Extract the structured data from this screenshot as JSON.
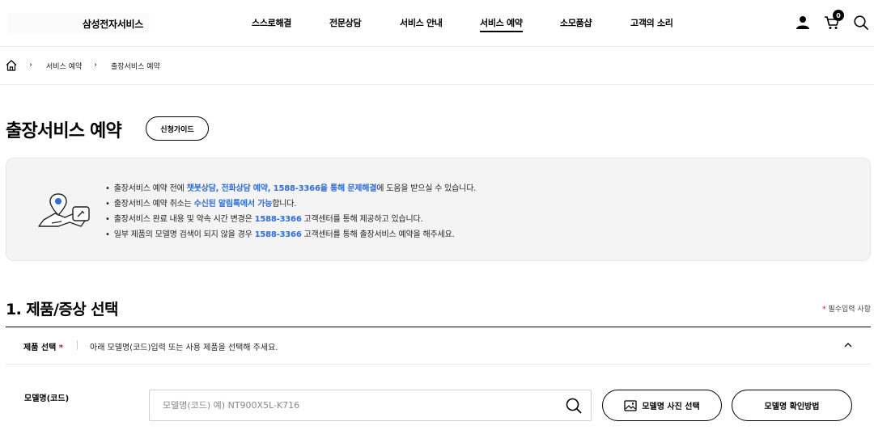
{
  "header": {
    "logo_text": "삼성전자서비스",
    "nav": [
      {
        "label": "스스로해결"
      },
      {
        "label": "전문상담"
      },
      {
        "label": "서비스 안내"
      },
      {
        "label": "서비스 예약"
      },
      {
        "label": "소모품샵"
      },
      {
        "label": "고객의 소리"
      }
    ],
    "active_nav": "서비스 예약",
    "cart_count": "0"
  },
  "breadcrumb": {
    "items": [
      {
        "label": "서비스 예약"
      },
      {
        "label": "출장서비스 예약"
      }
    ]
  },
  "page": {
    "title": "출장서비스 예약",
    "guide_button": "신청가이드"
  },
  "notice": {
    "line1": {
      "pre": "출장서비스 예약 전에 ",
      "highlight": "챗봇상담, 전화상담 예약, 1588-3366을 통해 문제해결",
      "post": "에 도움을 받으실 수 있습니다."
    },
    "line2": {
      "pre": "출장서비스 예약 취소는 ",
      "highlight": "수신된 알림톡에서 가능",
      "post": "합니다."
    },
    "line3": {
      "pre": "출장서비스 완료 내용 및 약속 시간 변경은 ",
      "highlight": "1588-3366",
      "post": " 고객센터를 통해 제공하고 있습니다."
    },
    "line4": {
      "pre": "일부 제품의 모델명 검색이 되지 않을 경우 ",
      "highlight": "1588-3366",
      "post": " 고객센터를 통해 출장서비스 예약을 해주세요."
    }
  },
  "section": {
    "title": "1. 제품/증상 선택",
    "required_star": "*",
    "required_text": " 필수입력 사항",
    "product_label": "제품 선택",
    "product_star": "*",
    "product_desc": "아래 모델명(코드)입력 또는 사용 제품을 선택해 주세요.",
    "model_label": "모델명(코드)",
    "model_placeholder": "모델명(코드) 예) NT900X5L-K716",
    "photo_button": "모델명 사진 선택",
    "howto_button": "모델명 확인방법"
  },
  "colors": {
    "highlight": "#2d6cdf",
    "required": "#e0002a"
  }
}
